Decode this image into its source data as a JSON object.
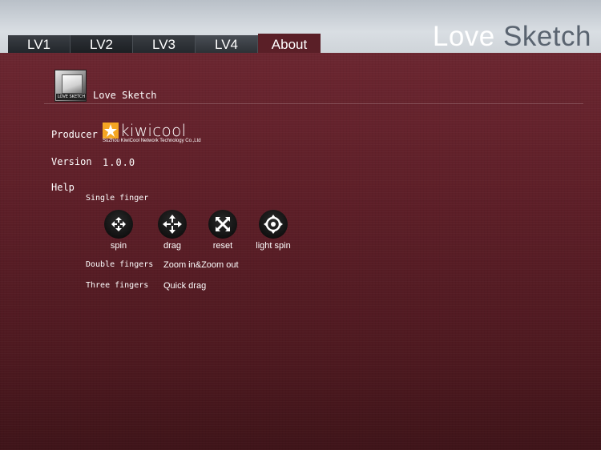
{
  "brand": {
    "word1": "Love",
    "word2": "Sketch"
  },
  "tabs": [
    {
      "label": "LV1"
    },
    {
      "label": "LV2"
    },
    {
      "label": "LV3"
    },
    {
      "label": "LV4"
    },
    {
      "label": "About",
      "active": true
    }
  ],
  "about": {
    "app_icon_text": "LOVE SKETCH",
    "app_name": "Love Sketch",
    "producer_label": "Producer",
    "producer_logo_word": "kiwicool",
    "producer_logo_subtitle": "SuZhou KiwiCool Network Technology Co.,Ltd",
    "version_label": "Version",
    "version_value": "1.0.0",
    "help_label": "Help",
    "single_finger_label": "Single finger",
    "gestures": [
      {
        "label": "spin",
        "icon": "spin-icon"
      },
      {
        "label": "drag",
        "icon": "drag-arrows-icon"
      },
      {
        "label": "reset",
        "icon": "reset-x-icon"
      },
      {
        "label": "light spin",
        "icon": "light-spin-icon"
      }
    ],
    "double_fingers_label": "Double fingers",
    "double_fingers_value": "Zoom in&Zoom out",
    "three_fingers_label": "Three fingers",
    "three_fingers_value": "Quick drag"
  },
  "colors": {
    "background": "#561c24",
    "topbar": "#d3d8dd",
    "accent_tab": "#5a1f27",
    "logo_orange": "#f5a623"
  }
}
